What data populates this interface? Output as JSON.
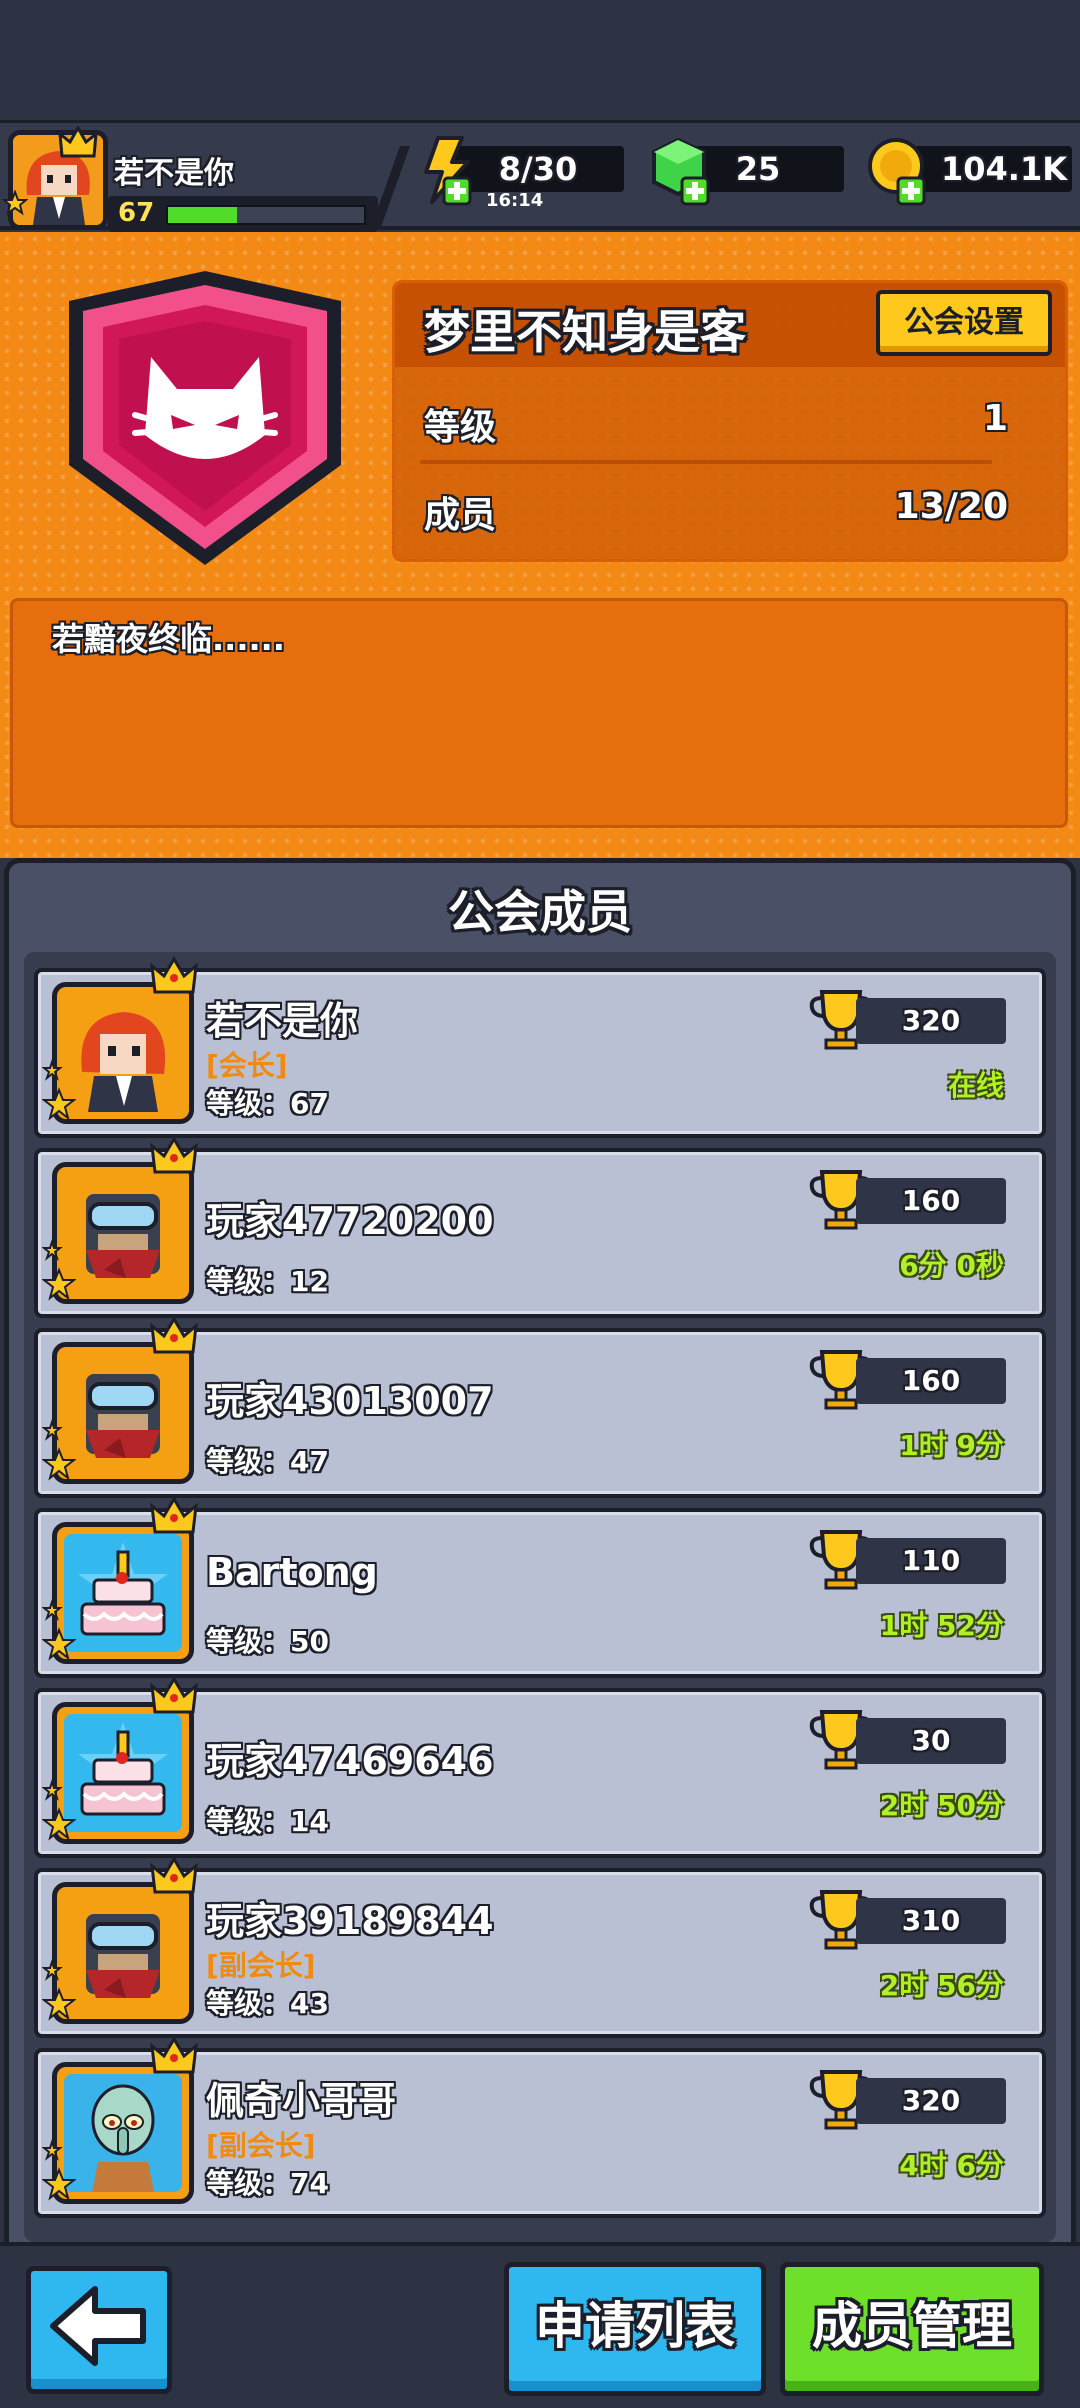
{
  "player": {
    "name": "若不是你",
    "level": "67",
    "xp_progress": 0.35
  },
  "resources": {
    "energy": "8/30",
    "energy_timer": "16:14",
    "gems": "25",
    "coins": "104.1K"
  },
  "guild": {
    "name": "梦里不知身是客",
    "settings_label": "公会设置",
    "level_label": "等级",
    "level_value": "1",
    "members_label": "成员",
    "members_value": "13/20",
    "description": "若黯夜终临......"
  },
  "members_panel": {
    "title": "公会成员",
    "level_prefix": "等级：",
    "rows": [
      {
        "name": "若不是你",
        "role": "[会长]",
        "level": "67",
        "trophies": "320",
        "status": "在线",
        "avatar": "orange-hair-girl"
      },
      {
        "name": "玩家47720200",
        "role": "",
        "level": "12",
        "trophies": "160",
        "status": "6分 0秒",
        "avatar": "ninja"
      },
      {
        "name": "玩家43013007",
        "role": "",
        "level": "47",
        "trophies": "160",
        "status": "1时 9分",
        "avatar": "ninja"
      },
      {
        "name": "Bartong",
        "role": "",
        "level": "50",
        "trophies": "110",
        "status": "1时 52分",
        "avatar": "birthday-cake"
      },
      {
        "name": "玩家47469646",
        "role": "",
        "level": "14",
        "trophies": "30",
        "status": "2时 50分",
        "avatar": "birthday-cake"
      },
      {
        "name": "玩家39189844",
        "role": "[副会长]",
        "level": "43",
        "trophies": "310",
        "status": "2时 56分",
        "avatar": "ninja"
      },
      {
        "name": "佩奇小哥哥",
        "role": "[副会长]",
        "level": "74",
        "trophies": "320",
        "status": "4时 6分",
        "avatar": "squid"
      }
    ]
  },
  "bottom": {
    "apply_list_label": "申请列表",
    "member_manage_label": "成员管理"
  },
  "colors": {
    "guild_orange": "#f48a16",
    "panel_grey": "#4a5166",
    "row_grey": "#b9c0d3",
    "online_green": "#b0f028",
    "role_orange": "#f08a10",
    "button_blue": "#2fb7f0",
    "button_green": "#6ee02a"
  }
}
